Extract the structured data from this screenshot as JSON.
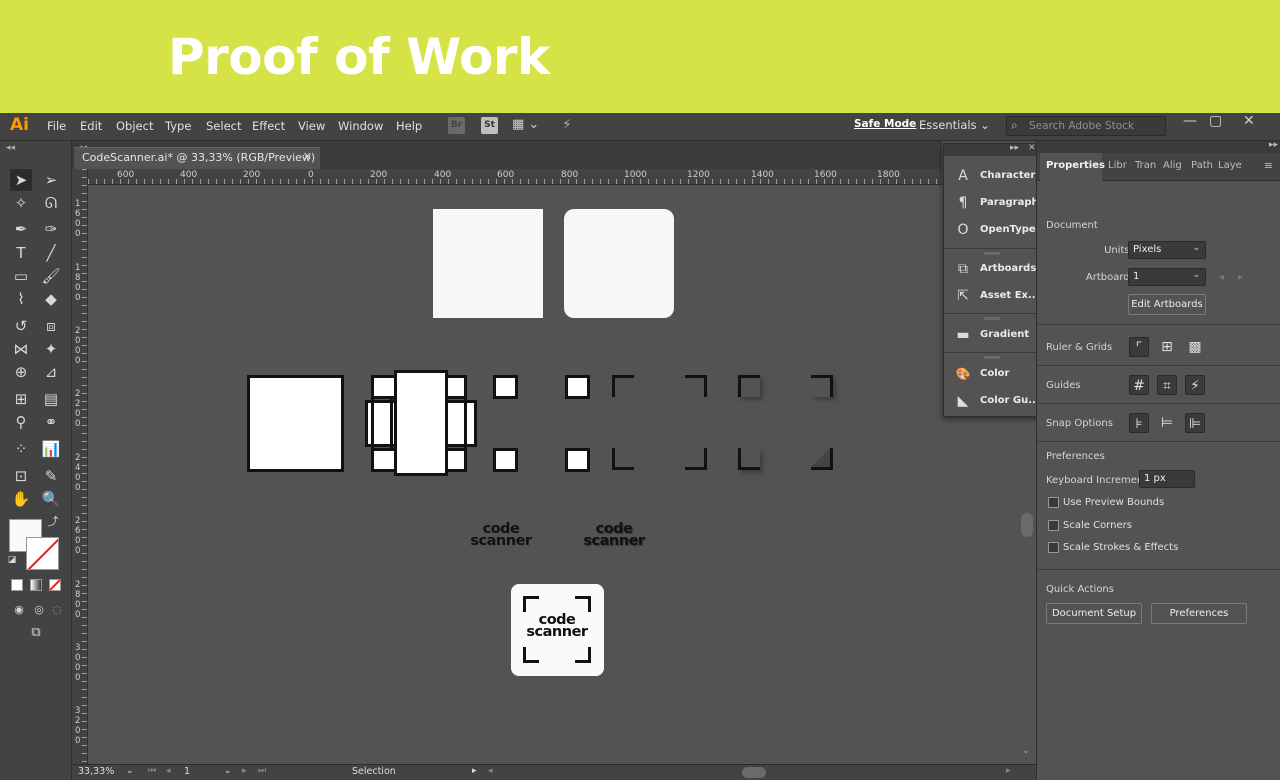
{
  "banner": {
    "title": "Proof of Work"
  },
  "app": {
    "logo": "Ai",
    "menus": [
      "File",
      "Edit",
      "Object",
      "Type",
      "Select",
      "Effect",
      "View",
      "Window",
      "Help"
    ],
    "bridge": "Br",
    "stock": "St",
    "safe_mode": "Safe Mode",
    "workspace": "Essentials",
    "search_placeholder": "Search Adobe Stock",
    "window_buttons": [
      "—",
      "▢",
      "✕"
    ]
  },
  "document": {
    "tab_title": "CodeScanner.ai* @ 33,33% (RGB/Preview)",
    "close": "✕"
  },
  "rulers": {
    "horizontal": [
      "600",
      "400",
      "200",
      "0",
      "200",
      "400",
      "600",
      "800",
      "1000",
      "1200",
      "1400",
      "1600",
      "1800"
    ],
    "vertical": [
      "1600",
      "1800",
      "2000",
      "2200",
      "2400",
      "2600",
      "2800",
      "3000",
      "3200"
    ]
  },
  "artwork": {
    "logo_line1": "code",
    "logo_line2": "scanner"
  },
  "status": {
    "zoom": "33,33%",
    "page": "1",
    "tool": "Selection"
  },
  "float_panel": {
    "items": [
      {
        "label": "Character",
        "icon": "character-icon",
        "glyph": "A"
      },
      {
        "label": "Paragraph",
        "icon": "paragraph-icon",
        "glyph": "¶"
      },
      {
        "label": "OpenType",
        "icon": "opentype-icon",
        "glyph": "O"
      },
      {
        "label": "Artboards",
        "icon": "artboards-icon",
        "glyph": "⧉"
      },
      {
        "label": "Asset Ex...",
        "icon": "asset-export-icon",
        "glyph": "⇱"
      },
      {
        "label": "Gradient",
        "icon": "gradient-icon",
        "glyph": "▬"
      },
      {
        "label": "Color",
        "icon": "color-icon",
        "glyph": "🎨"
      },
      {
        "label": "Color Gu...",
        "icon": "color-guide-icon",
        "glyph": "◣"
      }
    ]
  },
  "properties": {
    "tabs": [
      "Properties",
      "Libr",
      "Tran",
      "Alig",
      "Path",
      "Laye"
    ],
    "document_title": "Document",
    "units_label": "Units:",
    "units_value": "Pixels",
    "artboard_label": "Artboard:",
    "artboard_value": "1",
    "edit_artboards": "Edit Artboards",
    "ruler_grids": "Ruler & Grids",
    "guides": "Guides",
    "snap_options": "Snap Options",
    "preferences_title": "Preferences",
    "keyboard_increment_label": "Keyboard Increment:",
    "keyboard_increment_value": "1 px",
    "checkboxes": [
      "Use Preview Bounds",
      "Scale Corners",
      "Scale Strokes & Effects"
    ],
    "quick_actions": "Quick Actions",
    "document_setup": "Document Setup",
    "preferences_btn": "Preferences"
  },
  "colors": {
    "banner": "#d6e346",
    "ui_dark": "#434343",
    "canvas": "#535353",
    "accent_logo": "#ff9a00"
  }
}
